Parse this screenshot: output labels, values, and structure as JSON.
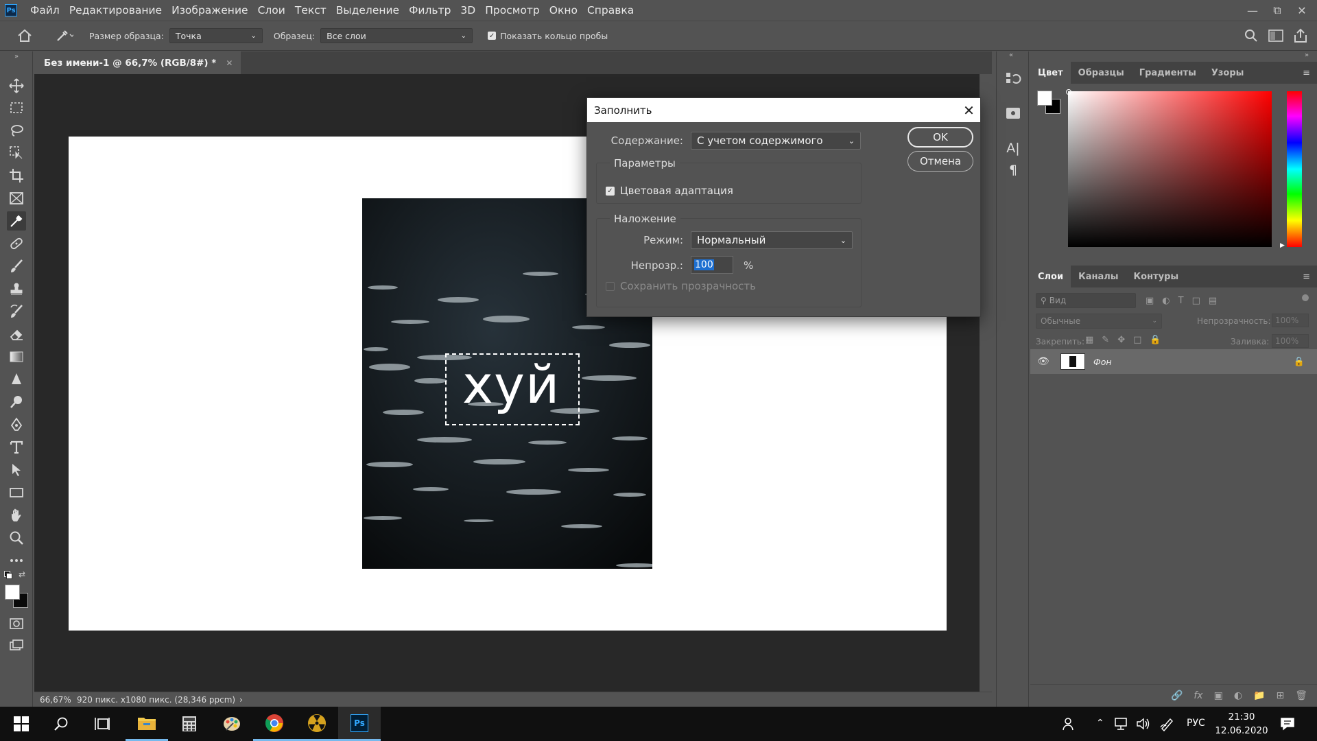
{
  "app": {
    "logo": "Ps"
  },
  "menu": [
    "Файл",
    "Редактирование",
    "Изображение",
    "Слои",
    "Текст",
    "Выделение",
    "Фильтр",
    "3D",
    "Просмотр",
    "Окно",
    "Справка"
  ],
  "options": {
    "sample_size_label": "Размер образца:",
    "sample_size_value": "Точка",
    "sample_label": "Образец:",
    "sample_value": "Все слои",
    "show_ring_label": "Показать кольцо пробы",
    "show_ring_checked": true
  },
  "document": {
    "tab_title": "Без имени-1 @ 66,7% (RGB/8#) *",
    "canvas_text": "хуй",
    "zoom": "66,67%",
    "info": "920 пикс. x1080 пикс. (28,346 ppcm)"
  },
  "color_panel": {
    "tabs": [
      "Цвет",
      "Образцы",
      "Градиенты",
      "Узоры"
    ],
    "active": "Цвет"
  },
  "layers_panel": {
    "tabs": [
      "Слои",
      "Каналы",
      "Контуры"
    ],
    "active": "Слои",
    "search_placeholder": "Вид",
    "blend_mode": "Обычные",
    "opacity_label": "Непрозрачность:",
    "opacity_value": "100%",
    "lock_label": "Закрепить:",
    "fill_label": "Заливка:",
    "fill_value": "100%",
    "layers": [
      {
        "name": "Фон",
        "visible": true,
        "locked": true
      }
    ]
  },
  "dialog": {
    "title": "Заполнить",
    "content_label": "Содержание:",
    "content_value": "С учетом содержимого",
    "params_legend": "Параметры",
    "color_adapt_label": "Цветовая адаптация",
    "color_adapt_checked": true,
    "blend_legend": "Наложение",
    "mode_label": "Режим:",
    "mode_value": "Нормальный",
    "opacity_label": "Непрозр.:",
    "opacity_value": "100",
    "opacity_unit": "%",
    "preserve_label": "Сохранить прозрачность",
    "preserve_checked": false,
    "ok_label": "OK",
    "cancel_label": "Отмена"
  },
  "taskbar": {
    "language": "РУС",
    "time": "21:30",
    "date": "12.06.2020"
  },
  "colors": {
    "accent": "#31a8ff",
    "ui_bg": "#535353",
    "dark_panel": "#424242",
    "canvas_bg": "#282828"
  }
}
